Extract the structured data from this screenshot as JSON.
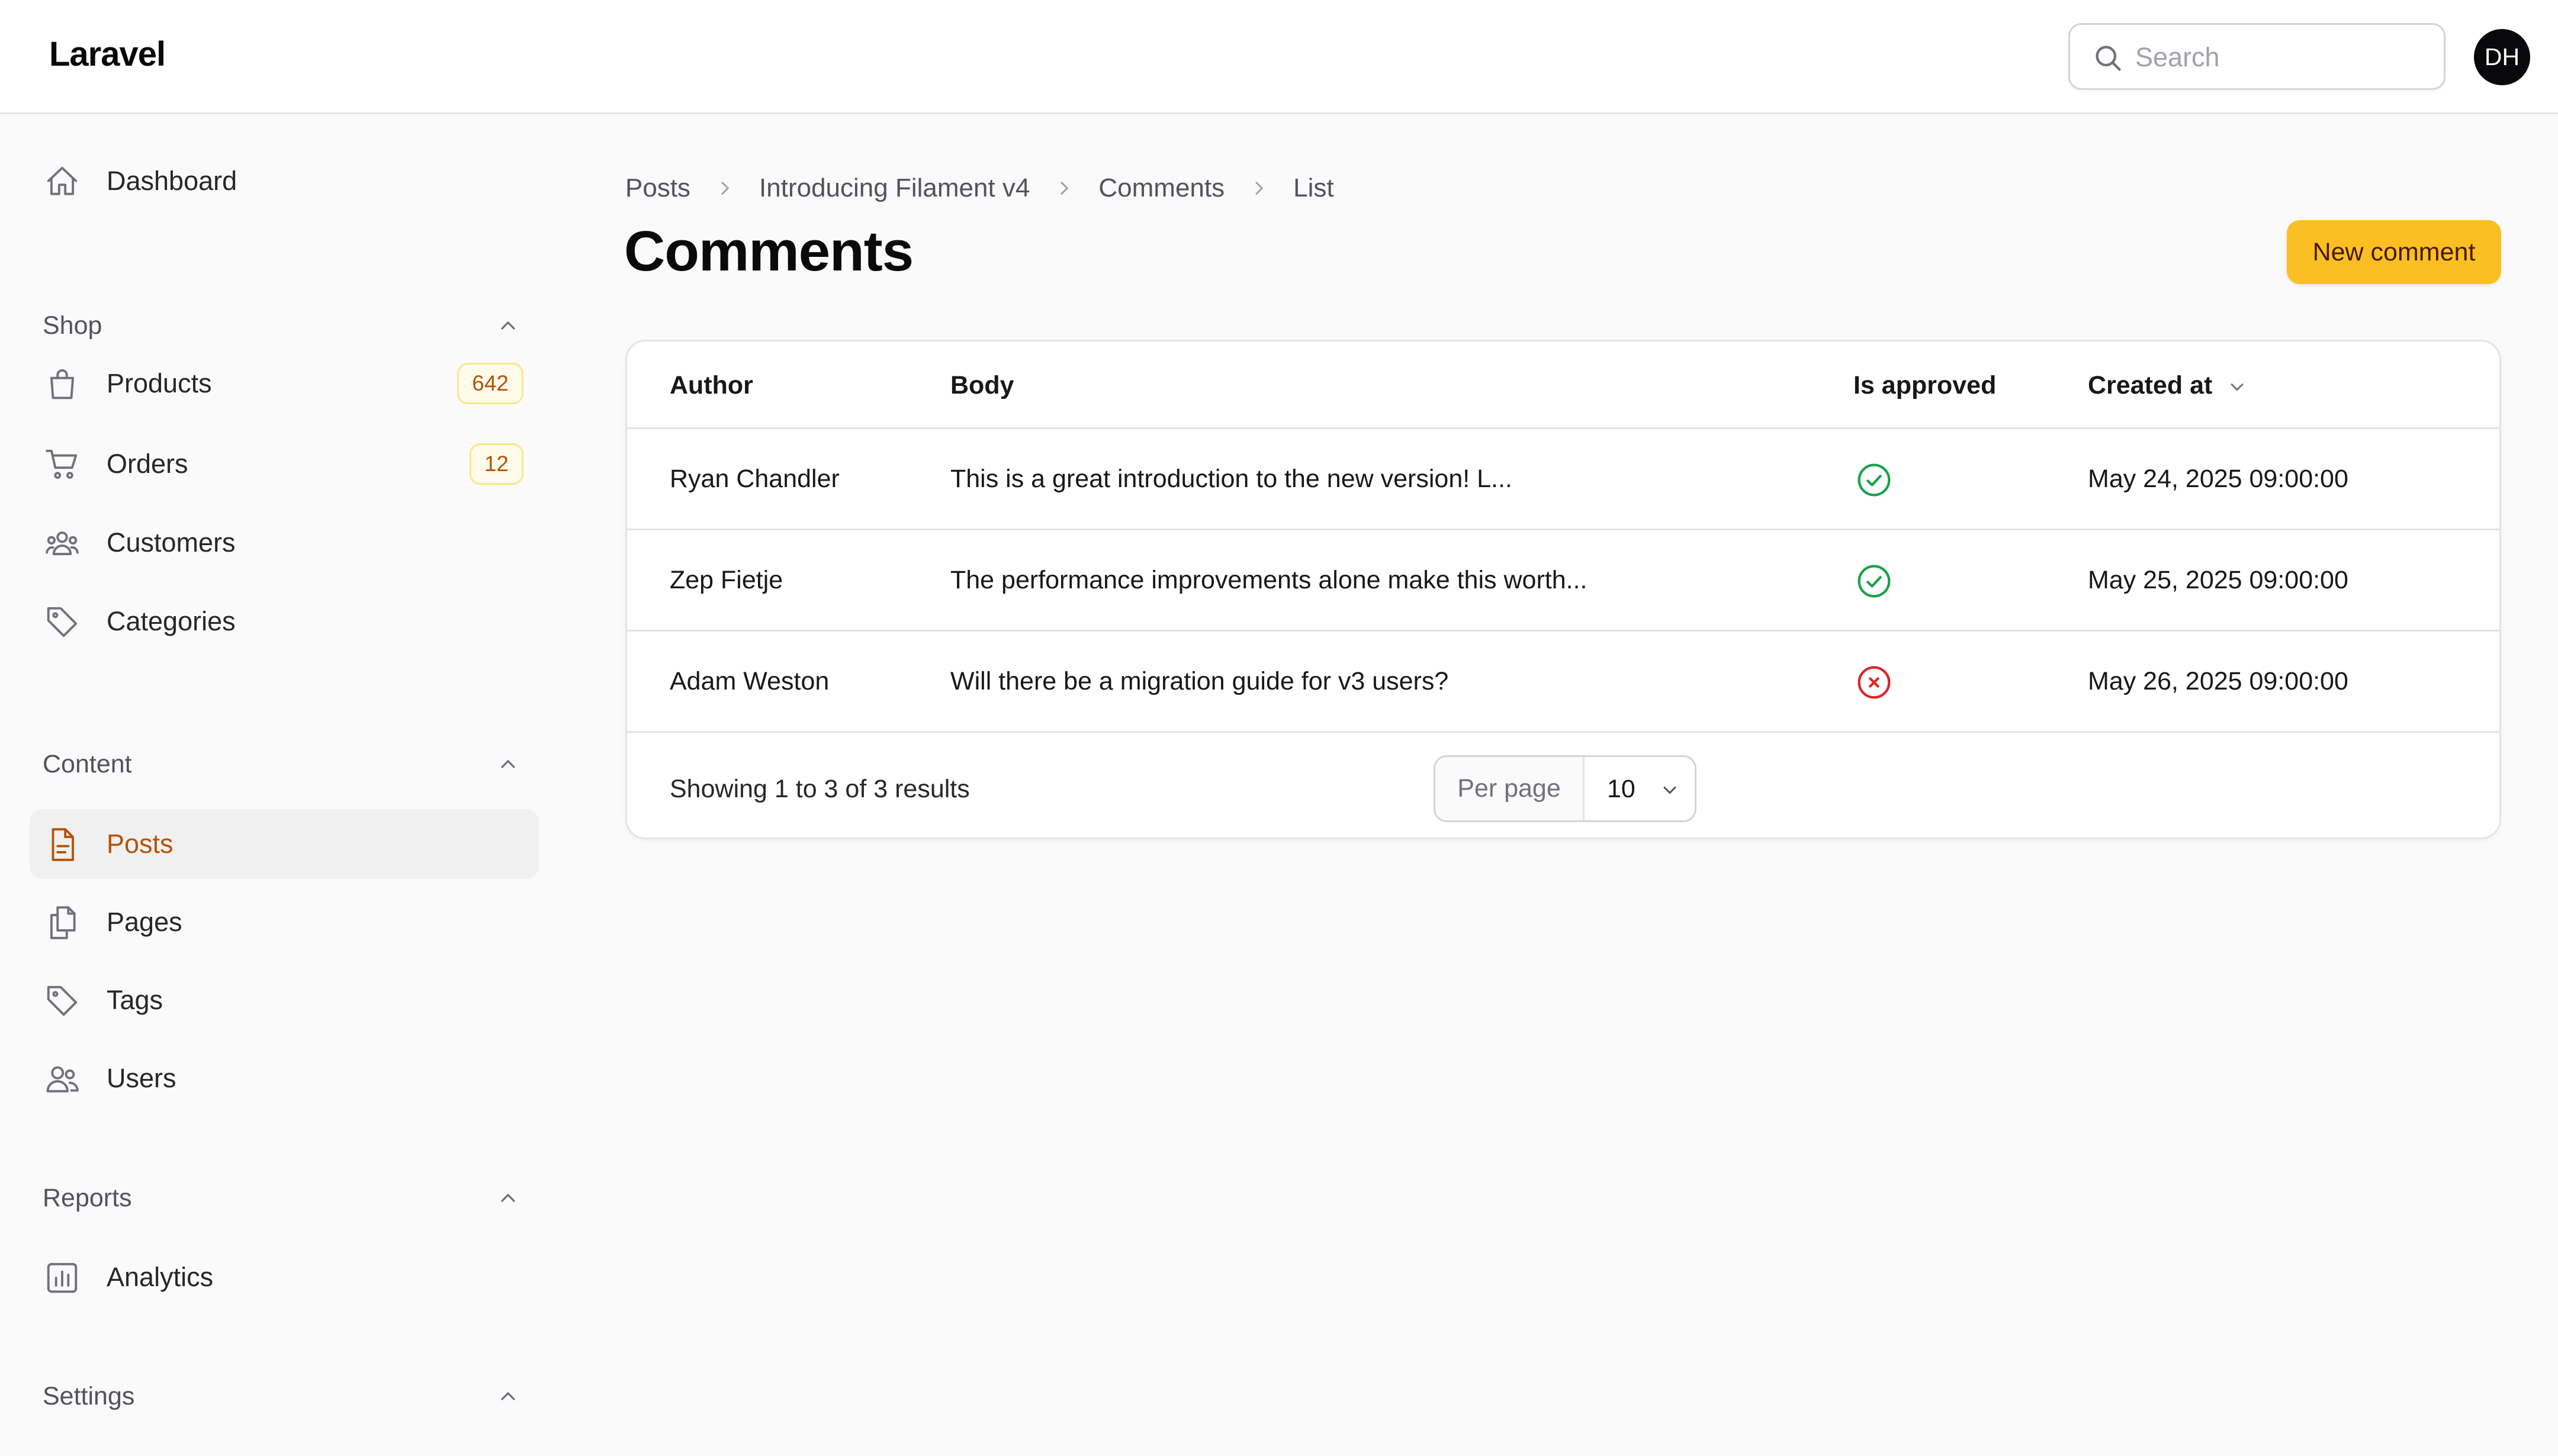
{
  "app": {
    "brand": "Laravel"
  },
  "header": {
    "search_placeholder": "Search",
    "user_initials": "DH"
  },
  "sidebar": {
    "dashboard": {
      "label": "Dashboard",
      "icon": "home-icon"
    },
    "groups": [
      {
        "label": "Shop",
        "items": [
          {
            "label": "Products",
            "icon": "shopping-bag-icon",
            "badge": "642"
          },
          {
            "label": "Orders",
            "icon": "shopping-cart-icon",
            "badge": "12"
          },
          {
            "label": "Customers",
            "icon": "user-group-icon"
          },
          {
            "label": "Categories",
            "icon": "tag-icon"
          }
        ]
      },
      {
        "label": "Content",
        "items": [
          {
            "label": "Posts",
            "icon": "document-text-icon",
            "active": true
          },
          {
            "label": "Pages",
            "icon": "document-duplicate-icon"
          },
          {
            "label": "Tags",
            "icon": "tag-icon"
          },
          {
            "label": "Users",
            "icon": "users-icon"
          }
        ]
      },
      {
        "label": "Reports",
        "items": [
          {
            "label": "Analytics",
            "icon": "chart-bar-icon"
          }
        ]
      },
      {
        "label": "Settings",
        "items": []
      }
    ]
  },
  "breadcrumb": [
    "Posts",
    "Introducing Filament v4",
    "Comments",
    "List"
  ],
  "page": {
    "title": "Comments",
    "new_button": "New comment"
  },
  "table": {
    "columns": [
      "Author",
      "Body",
      "Is approved",
      "Created at"
    ],
    "sort_column": "Created at",
    "rows": [
      {
        "author": "Ryan Chandler",
        "body": "This is a great introduction to the new version! L...",
        "approved": true,
        "created_at": "May 24, 2025 09:00:00"
      },
      {
        "author": "Zep Fietje",
        "body": "The performance improvements alone make this worth...",
        "approved": true,
        "created_at": "May 25, 2025 09:00:00"
      },
      {
        "author": "Adam Weston",
        "body": "Will there be a migration guide for v3 users?",
        "approved": false,
        "created_at": "May 26, 2025 09:00:00"
      }
    ],
    "footer": {
      "results_text": "Showing 1 to 3 of 3 results",
      "per_page_label": "Per page",
      "per_page_value": "10"
    }
  },
  "colors": {
    "accent": "#fbbf24",
    "active_text": "#b45309",
    "approved": "#16a34a",
    "rejected": "#dc2626"
  }
}
